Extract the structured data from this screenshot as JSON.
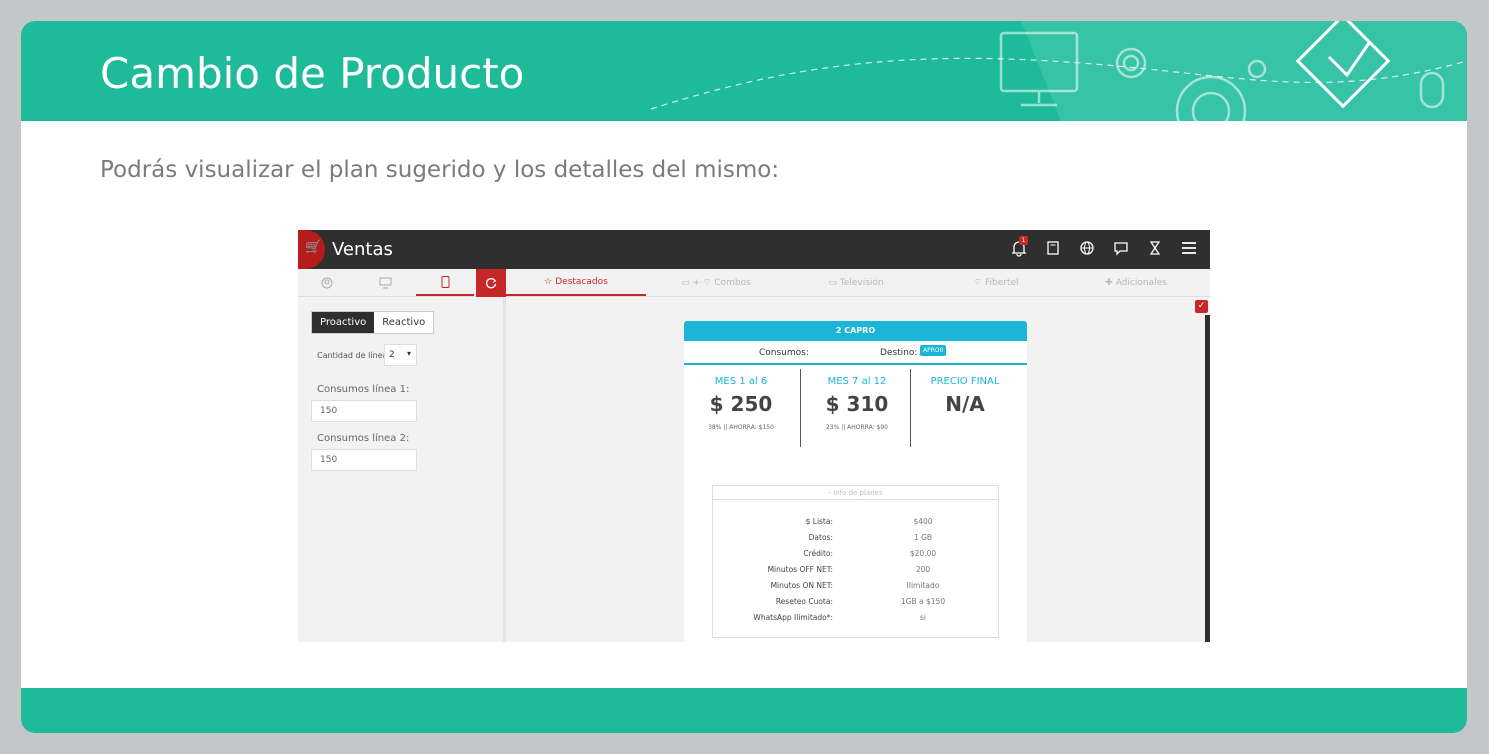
{
  "slide": {
    "title": "Cambio de Producto",
    "subtitle": "Podrás visualizar el plan sugerido y los detalles del mismo:"
  },
  "app": {
    "name": "Ventas",
    "notification_count": "1",
    "top_icons": [
      "bell-icon",
      "book-icon",
      "globe-icon",
      "chat-icon",
      "hourglass-icon",
      "menu-icon"
    ],
    "left_tabs": [
      "user-icon",
      "monitor-icon",
      "phone-icon"
    ],
    "right_tabs": [
      {
        "label": "Destacados",
        "icon": "star-icon",
        "active": true
      },
      {
        "label": "Combos",
        "icon": "monitor-wifi-icon"
      },
      {
        "label": "Televisión",
        "icon": "tv-icon"
      },
      {
        "label": "Fibertel",
        "icon": "wifi-icon"
      },
      {
        "label": "Adicionales",
        "icon": "plus-icon"
      }
    ]
  },
  "sidebar": {
    "segment_on": "Proactivo",
    "segment_off": "Reactivo",
    "lines_label": "Cantidad de líneas",
    "lines_value": "2",
    "line1_label": "Consumos línea 1:",
    "line1_value": "150",
    "line2_label": "Consumos línea 2:",
    "line2_value": "150"
  },
  "plan": {
    "name": "2 CAPRO",
    "consumos_label": "Consumos:",
    "destino_label": "Destino:",
    "destino_tag": "APRO0",
    "columns": [
      {
        "header": "MES 1 al 6",
        "value": "$ 250",
        "note": "38% || AHORRA: $150"
      },
      {
        "header": "MES 7 al 12",
        "value": "$ 310",
        "note": "23% || AHORRA: $90"
      },
      {
        "header": "PRECIO FINAL",
        "value": "N/A",
        "note": ""
      }
    ],
    "info_title": "- Info de planes",
    "info": [
      {
        "k": "$ Lista:",
        "v": "$400"
      },
      {
        "k": "Datos:",
        "v": "1 GB"
      },
      {
        "k": "Crédito:",
        "v": "$20.00"
      },
      {
        "k": "Minutos OFF NET:",
        "v": "200"
      },
      {
        "k": "Minutos ON NET:",
        "v": "Ilimitado"
      },
      {
        "k": "Reseteo Cuota:",
        "v": "1GB a $150"
      },
      {
        "k": "WhatsApp Ilimitado*:",
        "v": "si"
      }
    ]
  },
  "colors": {
    "teal": "#1dbb9a",
    "red": "#c62828",
    "cyan": "#1bb5d7",
    "dark": "#2f2f2f"
  }
}
